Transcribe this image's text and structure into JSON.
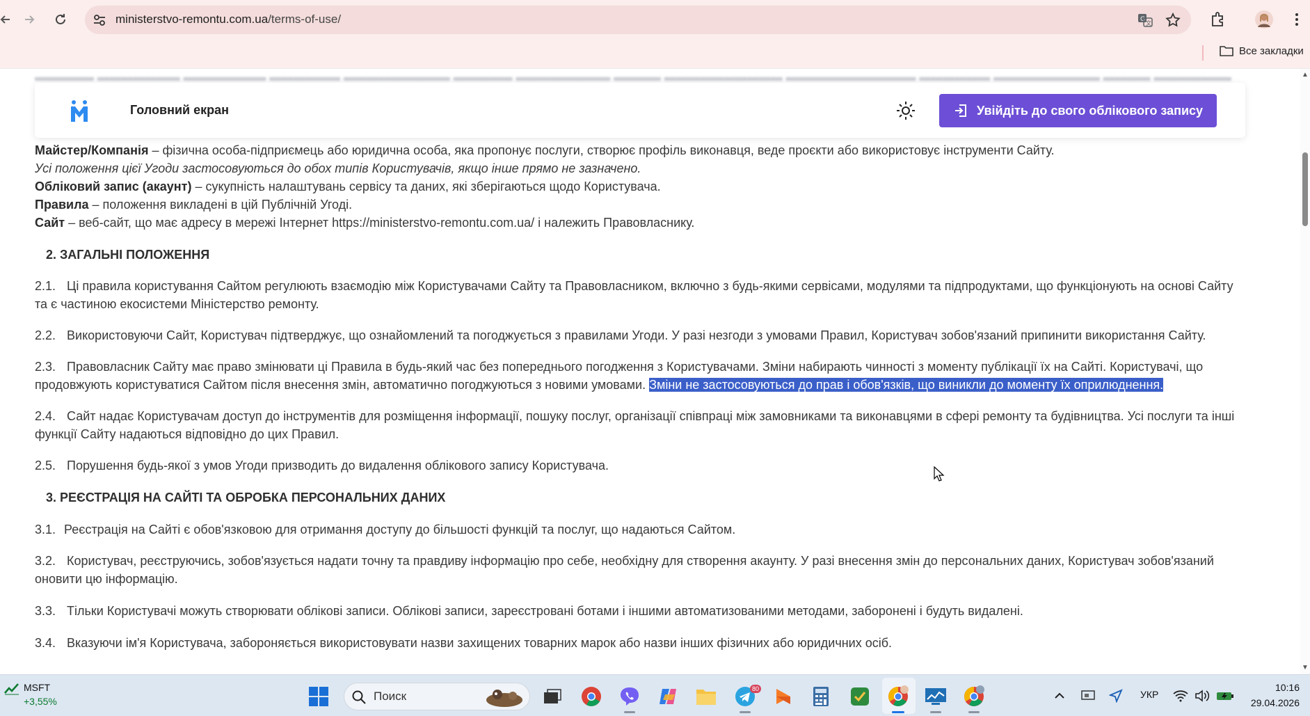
{
  "browser": {
    "url_domain": "ministerstvo-remontu.com.ua",
    "url_path": "/terms-of-use/",
    "bookmarks_all_label": "Все закладки"
  },
  "site_header": {
    "home_label": "Головний екран",
    "login_label": "Увійдіть до свого облікового запису",
    "accent_color": "#6c4fd6"
  },
  "definitions": {
    "master_term": "Майстер/Компанія",
    "master_text": " – фізична особа-підприємець або юридична особа, яка пропонує послуги, створює профіль виконавця, веде проєкти або використовує інструменти Сайту.",
    "both_types_note": "Усі положення цієї Угоди застосовуються до обох типів Користувачів, якщо інше прямо не зазначено.",
    "account_term": "Обліковий запис (акаунт)",
    "account_text": " – сукупність налаштувань сервісу та даних, які зберігаються щодо Користувача.",
    "rules_term": "Правила",
    "rules_text": " – положення викладені в цій Публічній Угоді.",
    "site_term": "Сайт",
    "site_text": " – веб-сайт, що має адресу в мережі Інтернет https://ministerstvo-remontu.com.ua/ і належить Правовласнику."
  },
  "section2": {
    "heading": "2. ЗАГАЛЬНІ ПОЛОЖЕННЯ",
    "p1_num": "2.1.",
    "p1_text": "Ці правила користування Сайтом регулюють взаємодію між Користувачами Сайту та Правовласником, включно з будь-якими сервісами, модулями та підпродуктами, що функціонують на основі Сайту та є частиною екосистеми Міністерство ремонту.",
    "p2_num": "2.2.",
    "p2_text": "Використовуючи Сайт, Користувач підтверджує, що ознайомлений та погоджується з правилами Угоди. У разі незгоди з умовами Правил, Користувач зобов'язаний припинити використання Сайту.",
    "p3_num": "2.3.",
    "p3_text": "Правовласник Сайту має право змінювати ці Правила в будь-який час без попереднього погодження з Користувачами. Зміни набирають чинності з моменту публікації їх на Сайті. Користувачі, що продовжують користуватися Сайтом після внесення змін, автоматично погоджуються з новими умовами. ",
    "p3_highlight": "Зміни не застосовуються до прав і обов'язків, що виникли до моменту їх оприлюднення.",
    "p4_num": "2.4.",
    "p4_text": "Сайт надає Користувачам доступ до інструментів для розміщення інформації, пошуку послуг, організації співпраці між замовниками та виконавцями в сфері ремонту та будівництва. Усі послуги та інші функції Сайту надаються відповідно до цих Правил.",
    "p5_num": "2.5.",
    "p5_text": "Порушення будь-якої з умов Угоди призводить до видалення облікового запису Користувача."
  },
  "section3": {
    "heading": "3. РЕЄСТРАЦІЯ НА САЙТІ ТА ОБРОБКА ПЕРСОНАЛЬНИХ ДАНИХ",
    "p1_num": "3.1.",
    "p1_text": "Реєстрація на Сайті є обов'язковою для отримання доступу до більшості функцій та послуг, що надаються Сайтом.",
    "p2_num": "3.2.",
    "p2_text": "Користувач, реєструючись, зобов'язується надати точну та правдиву інформацію про себе, необхідну для створення акаунту. У разі внесення змін до персональних даних, Користувач зобов'язаний оновити цю інформацію.",
    "p3_num": "3.3.",
    "p3_text": "Тільки Користувачі можуть створювати облікові записи. Облікові записи, зареєстровані ботами і іншими автоматизованими методами, заборонені і будуть видалені.",
    "p4_num": "3.4.",
    "p4_text": "Вказуючи ім'я Користувача, забороняється використовувати назви захищених товарних марок або назви інших фізичних або юридичних осіб."
  },
  "taskbar": {
    "stock_name": "MSFT",
    "stock_change": "+3,55%",
    "search_label": "Поиск",
    "telegram_badge": "80",
    "lang": "УКР",
    "time": "10:16",
    "date": "29.04.2026"
  }
}
